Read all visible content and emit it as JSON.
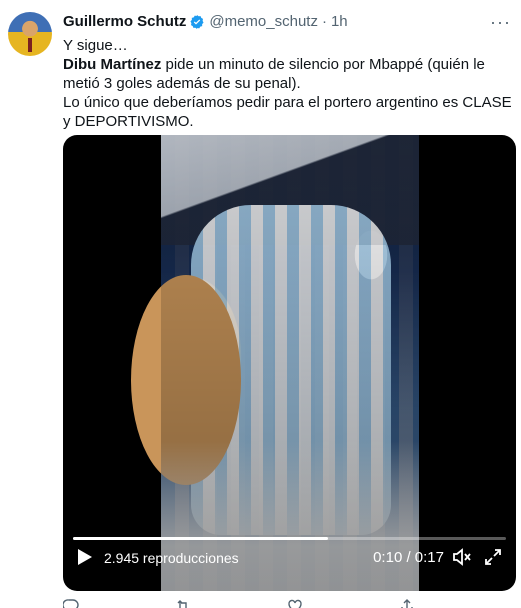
{
  "author": {
    "name": "Guillermo Schutz",
    "handle": "@memo_schutz",
    "separator": "·",
    "time": "1h",
    "more_icon": "more-dots-icon"
  },
  "tweet": {
    "line1": "Y sigue…",
    "line2_bold": "Dibu Martínez",
    "line2_rest": " pide un minuto de silencio por Mbappé (quién le metió 3 goles además de su penal).",
    "line3": "Lo único que deberíamos pedir para el portero argentino es CLASE y DEPORTIVISMO."
  },
  "video": {
    "views": "2.945 reproducciones",
    "timecode": "0:10 / 0:17",
    "progress": 0.588
  },
  "actions": {
    "reply_count": "",
    "retweet_count": "",
    "like_count": "",
    "share_label": ""
  },
  "colors": {
    "verified": "#1d9bf0",
    "secondary_text": "#536471"
  }
}
